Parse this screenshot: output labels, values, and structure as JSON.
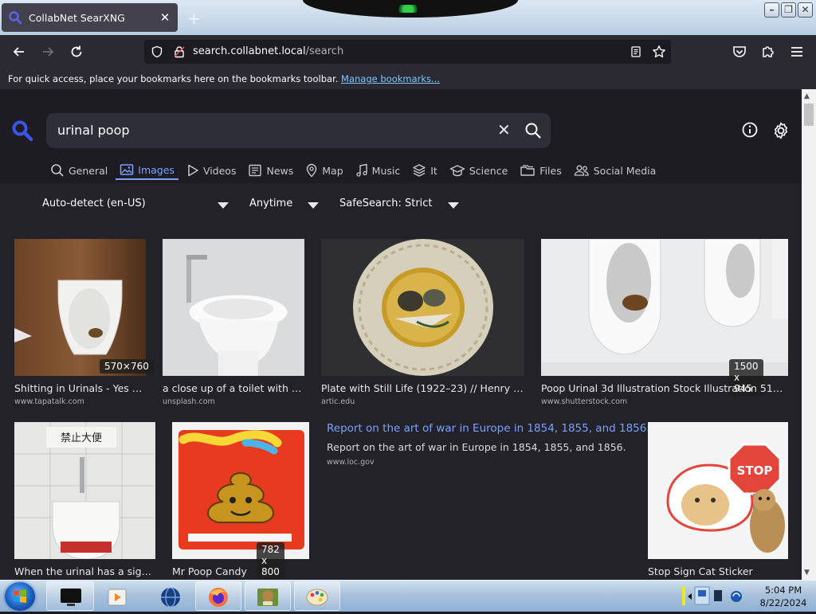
{
  "browser": {
    "tab_title": "CollabNet SearXNG",
    "url_host": "search.collabnet.local",
    "url_path": "/search",
    "bookmarks_message": "For quick access, place your bookmarks here on the bookmarks toolbar.",
    "bookmarks_link": "Manage bookmarks..."
  },
  "search": {
    "query": "urinal poop",
    "categories": [
      {
        "label": "General",
        "icon": "search-icon"
      },
      {
        "label": "Images",
        "icon": "image-icon",
        "active": true
      },
      {
        "label": "Videos",
        "icon": "play-icon"
      },
      {
        "label": "News",
        "icon": "newspaper-icon"
      },
      {
        "label": "Map",
        "icon": "map-pin-icon"
      },
      {
        "label": "Music",
        "icon": "music-note-icon"
      },
      {
        "label": "It",
        "icon": "layers-icon"
      },
      {
        "label": "Science",
        "icon": "graduation-cap-icon"
      },
      {
        "label": "Files",
        "icon": "files-icon"
      },
      {
        "label": "Social Media",
        "icon": "people-icon"
      }
    ],
    "filters": {
      "language": "Auto-detect (en-US)",
      "time": "Anytime",
      "safesearch": "SafeSearch: Strict"
    }
  },
  "results": [
    {
      "title": "Shitting in Urinals - Yes o...",
      "source": "www.tapatalk.com",
      "dimensions": "570×760"
    },
    {
      "title": "a close up of a toilet with a f...",
      "source": "unsplash.com",
      "dimensions": ""
    },
    {
      "title": "Plate with Still Life (1922–23) // Henry Var...",
      "source": "artic.edu",
      "dimensions": ""
    },
    {
      "title": "Poop Urinal 3d Illustration Stock Illustration 514084...",
      "source": "www.shutterstock.com",
      "dimensions": "1500 x 945"
    },
    {
      "title": "When the urinal has a sign t...",
      "source": "",
      "dimensions": "",
      "sign_text": "禁止大便"
    },
    {
      "title": "Mr Poop Candy",
      "source": "",
      "dimensions": "782 x 800"
    },
    {
      "title": "Stop Sign Cat Sticker",
      "source": "",
      "dimensions": "",
      "sign_text": "STOP"
    }
  ],
  "text_result": {
    "title": "Report on the art of war in Europe in 1854, 1855, and 1856.",
    "content": "Report on the art of war in Europe in 1854, 1855, and 1856.",
    "url": "www.loc.gov"
  },
  "taskbar": {
    "time": "5:04 PM",
    "date": "8/22/2024"
  },
  "colors": {
    "accent": "#7aa2ff",
    "page_bg": "#222228",
    "toolbar_bg": "#2b2a33"
  }
}
